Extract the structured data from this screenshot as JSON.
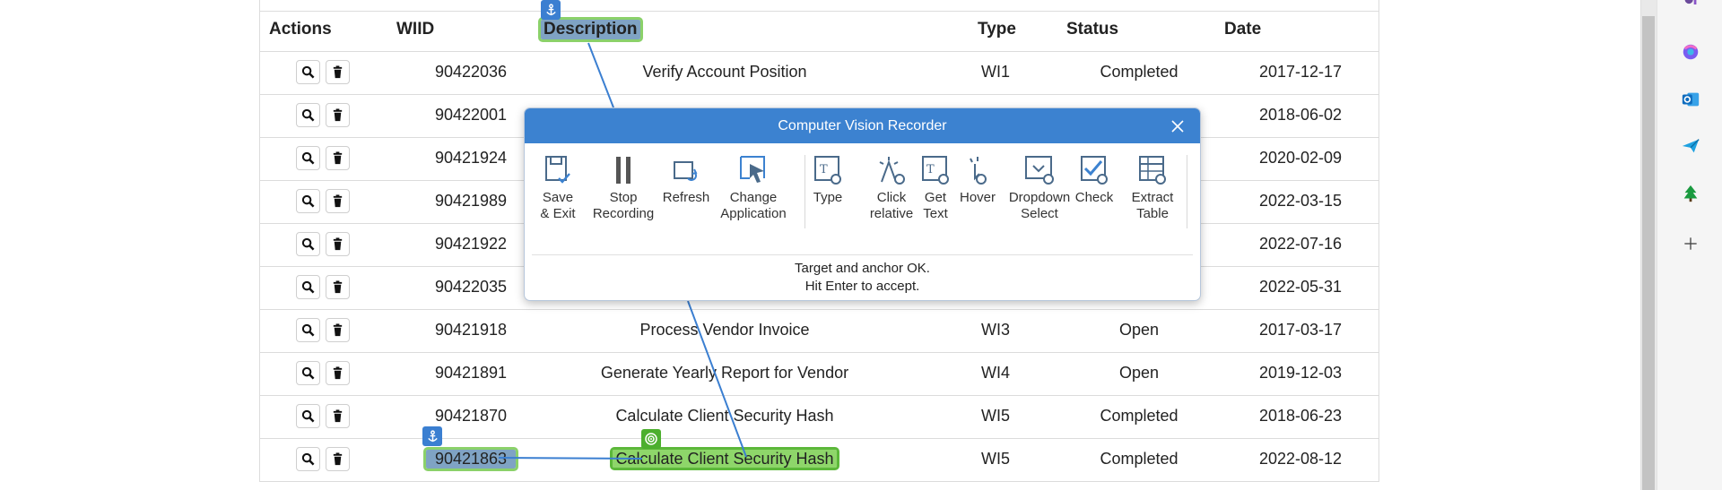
{
  "table": {
    "headers": {
      "actions": "Actions",
      "wiid": "WIID",
      "description": "Description",
      "type": "Type",
      "status": "Status",
      "date": "Date"
    },
    "rows": [
      {
        "wiid": "90422036",
        "description": "Verify Account Position",
        "type": "WI1",
        "status": "Completed",
        "date": "2017-12-17"
      },
      {
        "wiid": "90422001",
        "description": "",
        "type": "",
        "status": "",
        "date": "2018-06-02"
      },
      {
        "wiid": "90421924",
        "description": "",
        "type": "",
        "status": "",
        "date": "2020-02-09"
      },
      {
        "wiid": "90421989",
        "description": "",
        "type": "",
        "status": "",
        "date": "2022-03-15"
      },
      {
        "wiid": "90421922",
        "description": "",
        "type": "",
        "status": "",
        "date": "2022-07-16"
      },
      {
        "wiid": "90422035",
        "description": "",
        "type": "",
        "status": "",
        "date": "2022-05-31"
      },
      {
        "wiid": "90421918",
        "description": "Process Vendor Invoice",
        "type": "WI3",
        "status": "Open",
        "date": "2017-03-17"
      },
      {
        "wiid": "90421891",
        "description": "Generate Yearly Report for Vendor",
        "type": "WI4",
        "status": "Open",
        "date": "2019-12-03"
      },
      {
        "wiid": "90421870",
        "description": "Calculate Client Security Hash",
        "type": "WI5",
        "status": "Completed",
        "date": "2018-06-23"
      },
      {
        "wiid": "90421863",
        "description": "Calculate Client Security Hash",
        "type": "WI5",
        "status": "Completed",
        "date": "2022-08-12"
      }
    ]
  },
  "recorder": {
    "title": "Computer Vision Recorder",
    "tools": [
      {
        "label": "Save\n& Exit",
        "icon": "save-exit-icon"
      },
      {
        "label": "Stop\nRecording",
        "icon": "pause-icon"
      },
      {
        "label": "Refresh",
        "icon": "refresh-icon"
      },
      {
        "label": "Change\nApplication",
        "icon": "change-application-icon"
      },
      {
        "label": "Type",
        "icon": "type-icon"
      },
      {
        "label": "Click\nrelative",
        "icon": "click-relative-icon"
      },
      {
        "label": "Get\nText",
        "icon": "get-text-icon"
      },
      {
        "label": "Hover",
        "icon": "hover-icon"
      },
      {
        "label": "Dropdown\nSelect",
        "icon": "dropdown-select-icon"
      },
      {
        "label": "Check",
        "icon": "check-icon"
      },
      {
        "label": "Extract\nTable",
        "icon": "extract-table-icon"
      }
    ],
    "message_line1": "Target and anchor OK.",
    "message_line2": "Hit Enter to accept."
  },
  "colors": {
    "accent": "#3c82d0",
    "anchor_highlight": "#7fa3c4",
    "target_highlight": "#8ed66a",
    "target_border": "#5cb83a"
  }
}
